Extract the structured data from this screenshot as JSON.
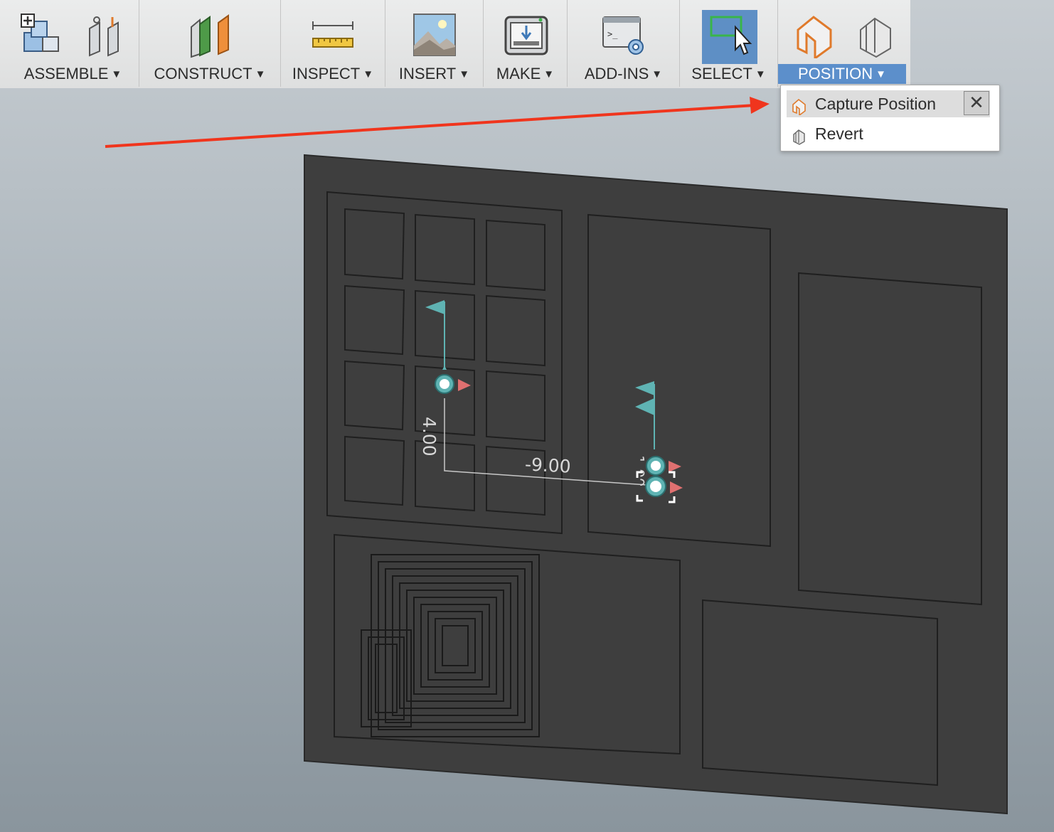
{
  "toolbar": {
    "groups": [
      {
        "label": "ASSEMBLE",
        "icons": [
          "new-component-icon",
          "joint-icon"
        ]
      },
      {
        "label": "CONSTRUCT",
        "icons": [
          "offset-plane-icon"
        ]
      },
      {
        "label": "INSPECT",
        "icons": [
          "measure-icon"
        ]
      },
      {
        "label": "INSERT",
        "icons": [
          "insert-image-icon"
        ]
      },
      {
        "label": "MAKE",
        "icons": [
          "3d-print-icon"
        ]
      },
      {
        "label": "ADD-INS",
        "icons": [
          "scripts-addins-icon"
        ]
      },
      {
        "label": "SELECT",
        "icons": [
          "window-select-icon"
        ]
      },
      {
        "label": "POSITION",
        "icons": [
          "capture-position-icon",
          "revert-position-icon"
        ]
      }
    ],
    "active_group": "POSITION",
    "caret": "▼"
  },
  "position_menu": {
    "items": [
      {
        "label": "Capture Position",
        "icon": "capture-position-icon",
        "highlighted": true
      },
      {
        "label": "Revert",
        "icon": "revert-position-icon",
        "highlighted": false
      }
    ],
    "close": "✕"
  },
  "viewport": {
    "dimensions": {
      "vertical": "4.00",
      "horizontal": "-9.00",
      "partial": "1.00"
    }
  },
  "colors": {
    "accent": "#5c8fcb",
    "panel": "#3e3e3e",
    "annotation_arrow": "#f0351d",
    "joint_teal": "#5fb3b3",
    "joint_red": "#e07070"
  }
}
